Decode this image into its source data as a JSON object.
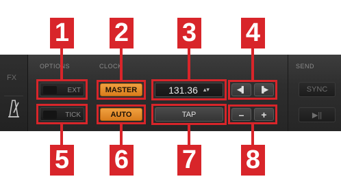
{
  "sidebar": {
    "fx_label": "FX",
    "metronome_icon": "metronome-icon"
  },
  "options": {
    "section_label": "OPTIONS",
    "ext_label": "EXT",
    "tick_label": "TICK"
  },
  "clock": {
    "section_label": "CLOCK",
    "master_label": "MASTER",
    "auto_label": "AUTO",
    "tempo_value": "131.36",
    "tempo_arrows": "▴▾",
    "tap_label": "TAP",
    "nudge_left_label": "◀▌",
    "nudge_right_label": "▐▶",
    "minus_label": "–",
    "plus_label": "+"
  },
  "send": {
    "section_label": "SEND",
    "sync_label": "SYNC",
    "play_label": "▶||"
  },
  "callouts": {
    "top": [
      "1",
      "2",
      "3",
      "4"
    ],
    "bottom": [
      "5",
      "6",
      "7",
      "8"
    ]
  },
  "colors": {
    "callout_red": "#d8252a",
    "active_orange": "#e8902e"
  }
}
